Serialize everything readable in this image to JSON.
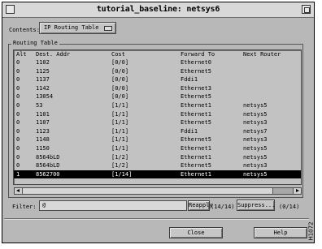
{
  "window": {
    "title": "tutorial_baseline: netsys6"
  },
  "contents": {
    "label": "Contents:",
    "selected": "IP Routing Table"
  },
  "routing_table": {
    "group_label": "Routing Table",
    "columns": [
      "Alt",
      "Dest. Addr",
      "Cost",
      "Forward To",
      "Next Router"
    ],
    "rows": [
      [
        "0",
        "1102",
        "[0/0]",
        "Ethernet0",
        ""
      ],
      [
        "0",
        "1125",
        "[0/0]",
        "Ethernet5",
        ""
      ],
      [
        "0",
        "1137",
        "[0/0]",
        "Fddi1",
        ""
      ],
      [
        "0",
        "1142",
        "[0/0]",
        "Ethernet3",
        ""
      ],
      [
        "0",
        "13054",
        "[0/0]",
        "Ethernet5",
        ""
      ],
      [
        "0",
        "53",
        "[1/1]",
        "Ethernet1",
        "netsys5"
      ],
      [
        "0",
        "1101",
        "[1/1]",
        "Ethernet1",
        "netsys5"
      ],
      [
        "0",
        "1107",
        "[1/1]",
        "Ethernet5",
        "netsys3"
      ],
      [
        "0",
        "1123",
        "[1/1]",
        "Fddi1",
        "netsys7"
      ],
      [
        "0",
        "1148",
        "[1/1]",
        "Ethernet5",
        "netsys3"
      ],
      [
        "0",
        "1150",
        "[1/1]",
        "Ethernet1",
        "netsys5"
      ],
      [
        "0",
        "8564bLD",
        "[1/2]",
        "Ethernet1",
        "netsys5"
      ],
      [
        "0",
        "8564bLD",
        "[1/2]",
        "Ethernet5",
        "netsys3"
      ],
      [
        "1",
        "8562700",
        "[1/14]",
        "Ethernet1",
        "netsys5"
      ]
    ],
    "selected_row": 13
  },
  "filter": {
    "label": "Filter:",
    "value": "@"
  },
  "buttons": {
    "reapply": "Reapply",
    "suppress": "Suppress...",
    "close": "Close",
    "help": "Help"
  },
  "counts": {
    "shown": "(14/14)",
    "total": "(0/14)"
  },
  "figure_id": "H1072"
}
